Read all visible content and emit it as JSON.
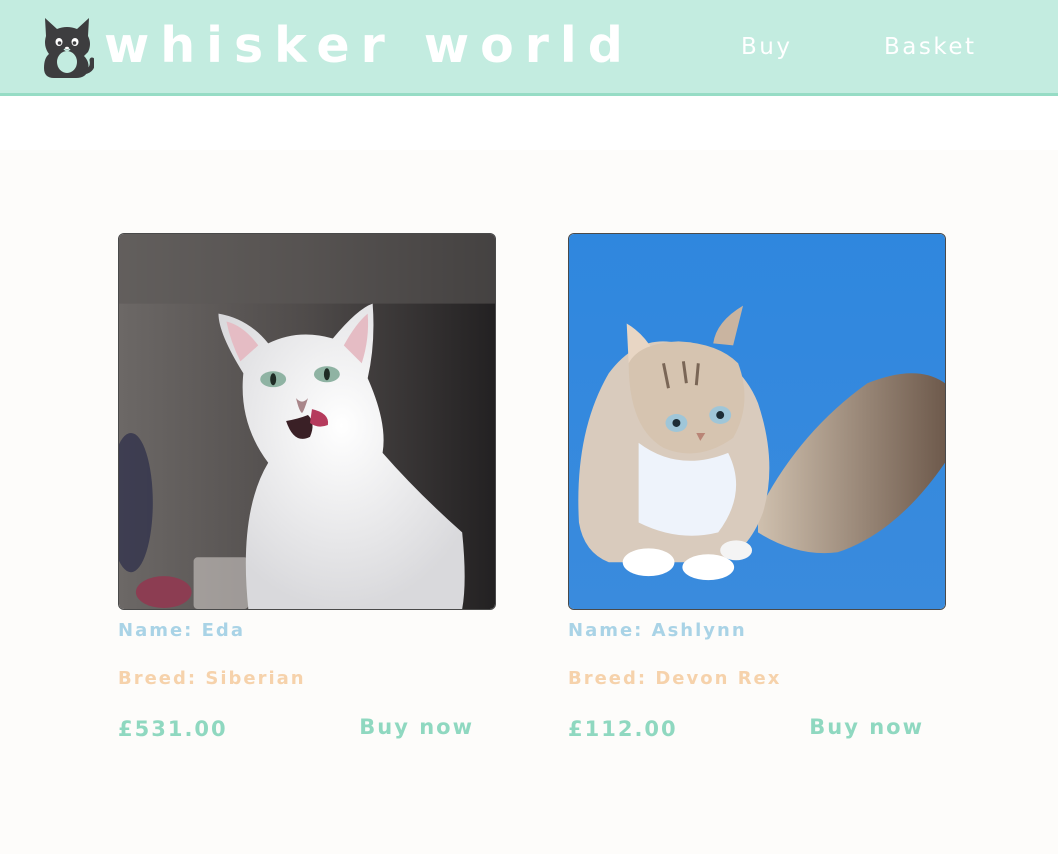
{
  "header": {
    "brand": "whisker world",
    "logo_icon": "cat-icon",
    "nav": [
      {
        "label": "Buy"
      },
      {
        "label": "Basket"
      }
    ]
  },
  "products": [
    {
      "name_label": "Name: Eda",
      "breed_label": "Breed: Siberian",
      "price": "£531.00",
      "buy_label": "Buy now",
      "photo": "white-cat-photo"
    },
    {
      "name_label": "Name: Ashlynn",
      "breed_label": "Breed: Devon Rex",
      "price": "£112.00",
      "buy_label": "Buy now",
      "photo": "fluffy-cat-photo"
    }
  ],
  "colors": {
    "header_bg": "#c3ece0",
    "accent": "#8fd8c0",
    "name": "#a9d3e6",
    "breed": "#f6d2ab"
  }
}
